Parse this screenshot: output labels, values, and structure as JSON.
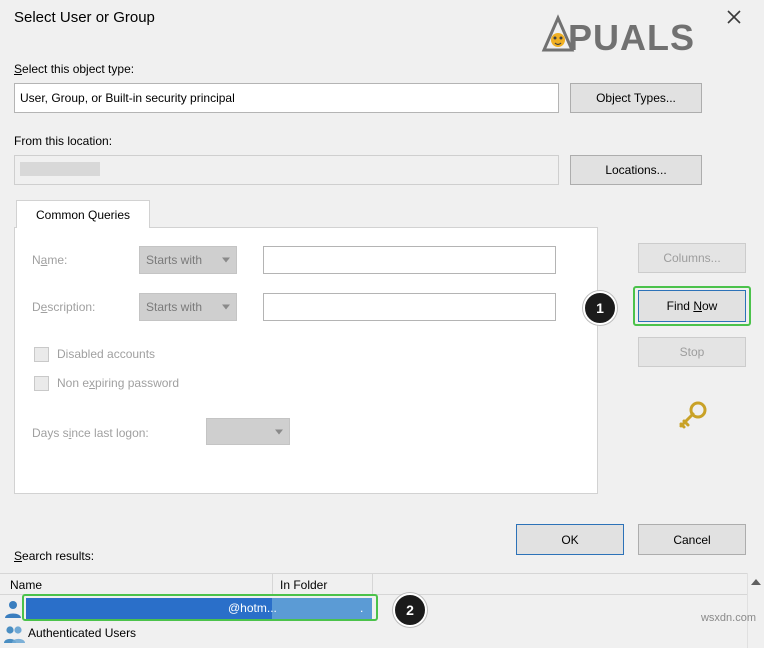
{
  "window": {
    "title": "Select User or Group",
    "close_icon": "close-icon",
    "watermark": "APPUALS",
    "footer_watermark": "wsxdn.com"
  },
  "fields": {
    "object_type_label": "Select this object type:",
    "object_type_value": "User, Group, or Built-in security principal",
    "location_label": "From this location:",
    "location_value": "",
    "object_types_button": "Object Types...",
    "locations_button": "Locations..."
  },
  "tabs": [
    {
      "label": "Common Queries",
      "selected": true
    }
  ],
  "query": {
    "name_label": "Name:",
    "name_operator": "Starts with",
    "name_value": "",
    "description_label": "Description:",
    "description_operator": "Starts with",
    "description_value": "",
    "disabled_accounts_label": "Disabled accounts",
    "non_expiring_password_label": "Non expiring password",
    "days_since_logon_label": "Days since last logon:",
    "days_since_logon_value": ""
  },
  "side_buttons": {
    "columns": "Columns...",
    "find_now": "Find Now",
    "stop": "Stop",
    "key_icon": "key-icon"
  },
  "footer_buttons": {
    "ok": "OK",
    "cancel": "Cancel"
  },
  "results": {
    "label": "Search results:",
    "columns": [
      "Name",
      "In Folder"
    ],
    "rows": [
      {
        "name": "@hotm...",
        "folder": ".",
        "selected": true,
        "icon": "user-icon"
      },
      {
        "name": "Authenticated Users",
        "folder": "",
        "selected": false,
        "icon": "group-icon"
      }
    ]
  },
  "annotations": [
    {
      "badge": "1",
      "target": "find-now-button"
    },
    {
      "badge": "2",
      "target": "result-row-selected"
    }
  ],
  "colors": {
    "accent_selection": "#2a6fc9",
    "highlight": "#4bc24b",
    "dialog_bg": "#f0f0f0"
  }
}
